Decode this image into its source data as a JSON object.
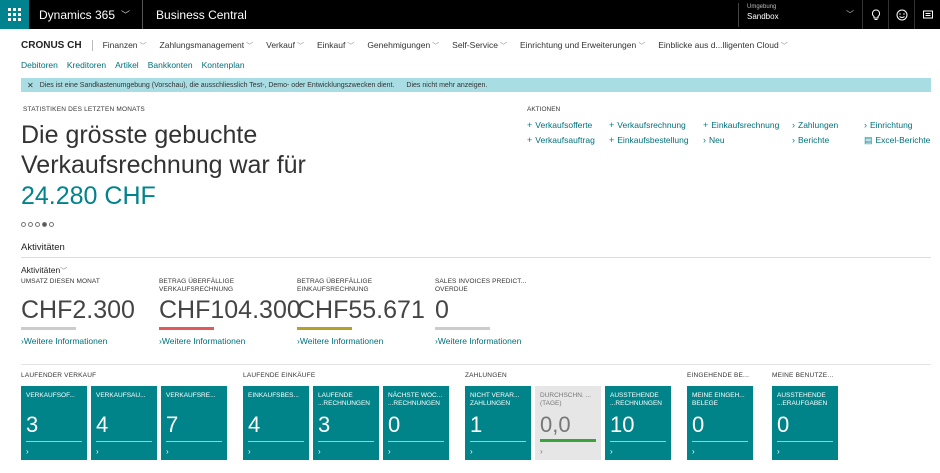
{
  "topbar": {
    "brand": "Dynamics 365",
    "app": "Business Central",
    "env_label": "Umgebung",
    "env_value": "Sandbox",
    "icons": [
      "lightbulb-icon",
      "smiley-icon",
      "chat-icon"
    ]
  },
  "menu": {
    "company": "CRONUS CH",
    "items": [
      "Finanzen",
      "Zahlungsmanagement",
      "Verkauf",
      "Einkauf",
      "Genehmigungen",
      "Self-Service",
      "Einrichtung und Erweiterungen",
      "Einblicke aus d...lligenten Cloud"
    ]
  },
  "quicklinks": [
    "Debitoren",
    "Kreditoren",
    "Artikel",
    "Bankkonten",
    "Kontenplan"
  ],
  "notice": {
    "text": "Dies ist eine Sandkastenumgebung (Vorschau), die ausschliesslich Test-, Demo- oder Entwicklungszwecken dient.",
    "dismiss": "Dies nicht mehr anzeigen."
  },
  "headline": {
    "section": "STATISTIKEN DES LETZTEN MONATS",
    "text_line1": "Die grösste gebuchte",
    "text_line2": "Verkaufsrechnung war für",
    "value": "24.280 CHF"
  },
  "actions": {
    "title": "AKTIONEN",
    "items": [
      {
        "icon": "+",
        "label": "Verkaufsofferte"
      },
      {
        "icon": "+",
        "label": "Verkaufsrechnung"
      },
      {
        "icon": "+",
        "label": "Einkaufsrechnung"
      },
      {
        "icon": "›",
        "label": "Zahlungen"
      },
      {
        "icon": "›",
        "label": "Einrichtung"
      },
      {
        "icon": "+",
        "label": "Verkaufsauftrag"
      },
      {
        "icon": "+",
        "label": "Einkaufsbestellung"
      },
      {
        "icon": "›",
        "label": "Neu"
      },
      {
        "icon": "›",
        "label": "Berichte"
      },
      {
        "icon": "▤",
        "label": "Excel-Berichte"
      }
    ]
  },
  "activities": {
    "title": "Aktivitäten",
    "subtitle": "Aktivitäten",
    "kpis": [
      {
        "label1": "UMSATZ DIESEN MONAT",
        "label2": "",
        "value": "CHF2.300",
        "bar_color": "#cccccc",
        "more": "Weitere Informationen"
      },
      {
        "label1": "BETRAG ÜBERFÄLLIGE",
        "label2": "VERKAUFSRECHNUNG",
        "value": "CHF104.300",
        "bar_color": "#e05a5a",
        "more": "Weitere Informationen"
      },
      {
        "label1": "BETRAG ÜBERFÄLLIGE",
        "label2": "EINKAUFSRECHNUNG",
        "value": "CHF55.671",
        "bar_color": "#b5a128",
        "more": "Weitere Informationen"
      },
      {
        "label1": "SALES INVOICES PREDICT...",
        "label2": "OVERDUE",
        "value": "0",
        "bar_color": "#cccccc",
        "more": "Weitere Informationen"
      }
    ]
  },
  "cue_groups": [
    {
      "title": "LAUFENDER VERKAUF"
    },
    {
      "title": "LAUFENDE EINKÄUFE"
    },
    {
      "title": "ZAHLUNGEN"
    },
    {
      "title": "EINGEHENDE BE..."
    },
    {
      "title": "MEINE BENUTZE..."
    }
  ],
  "tiles": [
    {
      "label": "VERKAUFSOF...",
      "value": "3"
    },
    {
      "label": "VERKAUFSAU...",
      "value": "4"
    },
    {
      "label": "VERKAUFSRE...",
      "value": "7"
    },
    {
      "label": "EINKAUFSBES...",
      "value": "4"
    },
    {
      "label": "LAUFENDE ...RECHNUNGEN",
      "value": "3"
    },
    {
      "label": "NÄCHSTE WOC... ...RECHNUNGEN",
      "value": "0"
    },
    {
      "label": "NICHT VERAR... ZAHLUNGEN",
      "value": "1"
    },
    {
      "label": "DURCHSCHN. ... (TAGE)",
      "value": "0,0"
    },
    {
      "label": "AUSSTEHENDE ...RECHNUNGEN",
      "value": "10"
    },
    {
      "label": "MEINE EINGEH... BELEGE",
      "value": "0"
    },
    {
      "label": "AUSSTEHENDE ...ERAUFGABEN",
      "value": "0"
    }
  ]
}
